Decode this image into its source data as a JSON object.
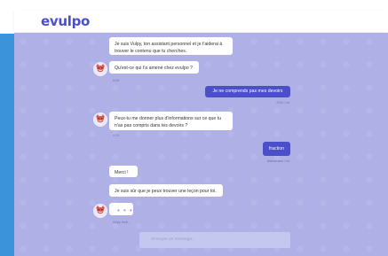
{
  "app": {
    "logo_text": "evulpo"
  },
  "chat": {
    "messages": [
      {
        "type": "bot",
        "text": "Je suis Vulpy, ton assistant personnel et je t'aiderai à trouver le contenu que tu cherches."
      },
      {
        "type": "bot",
        "text": "Qu'est-ce qui t'a amené chez evulpo ?"
      },
      {
        "type": "timestamp",
        "text": "9:33"
      },
      {
        "type": "user",
        "text": "Je ne comprends pas mes devoirs"
      },
      {
        "type": "timestamp",
        "text": "9:33 • Vu"
      },
      {
        "type": "bot",
        "text": "Peux-tu me donner plus d'informations sur ce que tu n'as pas compris dans tes devoirs ?"
      },
      {
        "type": "timestamp",
        "text": "9:33"
      },
      {
        "type": "user",
        "text": "fraction"
      },
      {
        "type": "timestamp",
        "text": "Maintenant • Vu"
      },
      {
        "type": "bot",
        "text": "Merci !"
      },
      {
        "type": "bot",
        "text": "Je suis sûr que je peux trouver une leçon pour toi."
      },
      {
        "type": "typing",
        "text": "• • •"
      },
      {
        "type": "status",
        "text": "Vulpy écrit..."
      }
    ]
  },
  "composer": {
    "placeholder": "Envoyer un message..."
  },
  "colors": {
    "accent": "#4b4fc8",
    "chat_bg": "#aeb0e6",
    "side_strip": "#3b94d9"
  },
  "icons": {
    "avatar": "fox-avatar-icon"
  }
}
